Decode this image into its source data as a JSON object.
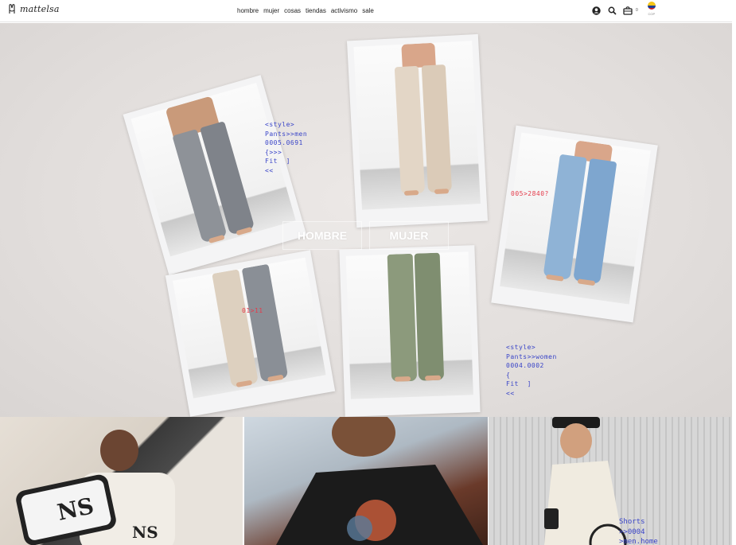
{
  "brand": {
    "name": "mattelsa"
  },
  "nav": {
    "items": [
      "hombre",
      "mujer",
      "cosas",
      "tiendas",
      "activismo",
      "sale"
    ]
  },
  "header": {
    "icons": [
      "account-icon",
      "search-icon",
      "cart-icon"
    ],
    "cart_count": "0",
    "currency": "COP",
    "country_flag": "colombia-flag-icon"
  },
  "hero": {
    "note_men": "<style>\nPants>>men\n0005.0691\n{>>>\nFit  ]\n<<",
    "note_women": "<style>\nPants>>women\n0004.0002\n{\nFit  ]\n<<",
    "code_red_1": "005>2840?",
    "code_red_2": "01>11",
    "cta_men": "HOMBRE",
    "cta_women": "MUJER"
  },
  "tiles": {
    "tile3_note": "Shorts\n>>0004\n>men.home"
  },
  "colors": {
    "accent_blue": "#3a45c8",
    "accent_red": "#e43b4b"
  }
}
